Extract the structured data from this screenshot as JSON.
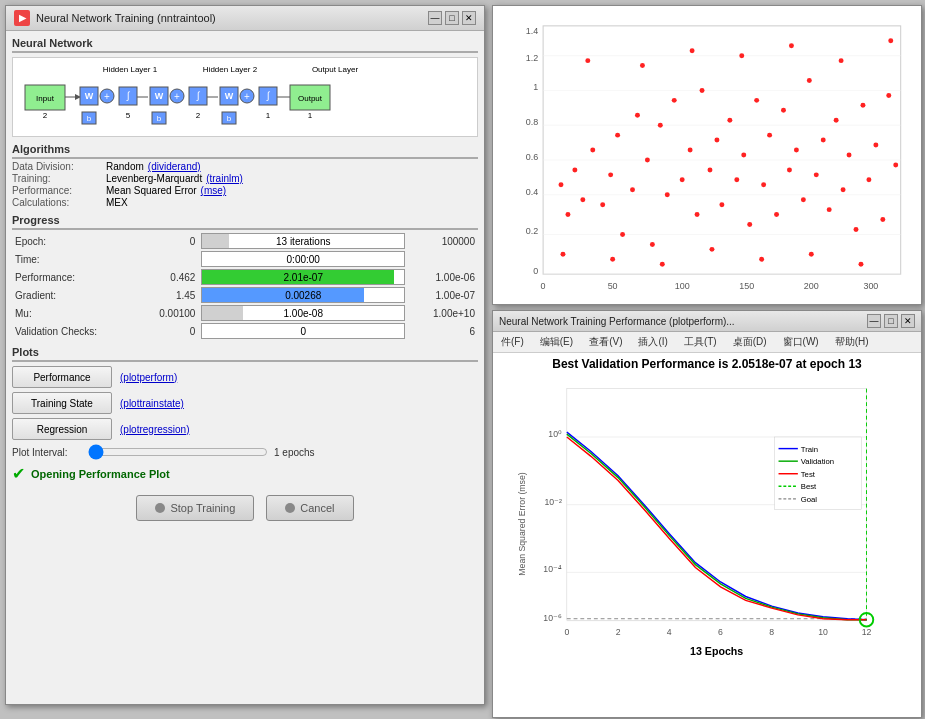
{
  "mainWindow": {
    "title": "Neural Network Training (nntraintool)",
    "titleIcon": "NN",
    "sections": {
      "neuralNetwork": {
        "label": "Neural Network"
      },
      "algorithms": {
        "label": "Algorithms",
        "rows": [
          {
            "label": "Data Division:",
            "value": "Random",
            "link": "(dividerand)"
          },
          {
            "label": "Training:",
            "value": "Levenberg-Marquardt",
            "link": "(trainlm)"
          },
          {
            "label": "Performance:",
            "value": "Mean Squared Error",
            "link": "(mse)"
          },
          {
            "label": "Calculations:",
            "value": "MEX",
            "link": ""
          }
        ]
      },
      "progress": {
        "label": "Progress",
        "rows": [
          {
            "label": "Epoch:",
            "current": "0",
            "barText": "13 iterations",
            "barPct": 13,
            "max": "100000",
            "showBar": true,
            "barColor": "#d0d0d0"
          },
          {
            "label": "Time:",
            "current": "",
            "barText": "0:00:00",
            "barPct": 0,
            "max": "",
            "showBar": true,
            "barColor": "#d0d0d0"
          },
          {
            "label": "Performance:",
            "current": "0.462",
            "barText": "2.01e-07",
            "barPct": 95,
            "max": "1.00e-06",
            "showBar": true,
            "barColor": "#33cc33"
          },
          {
            "label": "Gradient:",
            "current": "1.45",
            "barText": "0.00268",
            "barPct": 80,
            "max": "1.00e-07",
            "showBar": true,
            "barColor": "#5599ff"
          },
          {
            "label": "Mu:",
            "current": "0.00100",
            "barText": "1.00e-08",
            "barPct": 20,
            "max": "1.00e+10",
            "showBar": true,
            "barColor": "#d0d0d0"
          },
          {
            "label": "Validation Checks:",
            "current": "0",
            "barText": "0",
            "barPct": 0,
            "max": "6",
            "showBar": true,
            "barColor": "#d0d0d0"
          }
        ]
      },
      "plots": {
        "label": "Plots",
        "buttons": [
          {
            "label": "Performance",
            "link": "(plotperform)"
          },
          {
            "label": "Training State",
            "link": "(plottrainstate)"
          },
          {
            "label": "Regression",
            "link": "(plotregression)"
          }
        ],
        "interval": {
          "label": "Plot Interval:",
          "value": "1 epochs"
        }
      }
    },
    "status": "Opening Performance Plot",
    "buttons": {
      "stopTraining": "Stop Training",
      "cancel": "Cancel"
    }
  },
  "perfWindow": {
    "title": "Neural Network Training Performance (plotperform)...",
    "subtitle": "Best Validation Performance is 2.0518e-07 at epoch 13",
    "menus": [
      "件(F)",
      "编辑(E)",
      "查看(V)",
      "插入(I)",
      "工具(T)",
      "桌面(D)",
      "窗口(W)",
      "帮助(H)"
    ],
    "xLabel": "13 Epochs",
    "yLabel": "Mean Squared Error (mse)",
    "legend": {
      "items": [
        {
          "label": "Train",
          "color": "#0000ff",
          "dash": false
        },
        {
          "label": "Validation",
          "color": "#00aa00",
          "dash": false
        },
        {
          "label": "Test",
          "color": "#ff0000",
          "dash": false
        },
        {
          "label": "Best",
          "color": "#00cc00",
          "dash": true
        },
        {
          "label": "Goal",
          "color": "#888888",
          "dash": true
        }
      ]
    }
  },
  "nnDiagram": {
    "layers": [
      {
        "label": "Input",
        "sublabel": "2"
      },
      {
        "label": "Hidden Layer 1",
        "sublabel": "5"
      },
      {
        "label": "Hidden Layer 2",
        "sublabel": "2"
      },
      {
        "label": "Output Layer",
        "sublabel": "1"
      },
      {
        "label": "Output",
        "sublabel": "1"
      }
    ]
  }
}
